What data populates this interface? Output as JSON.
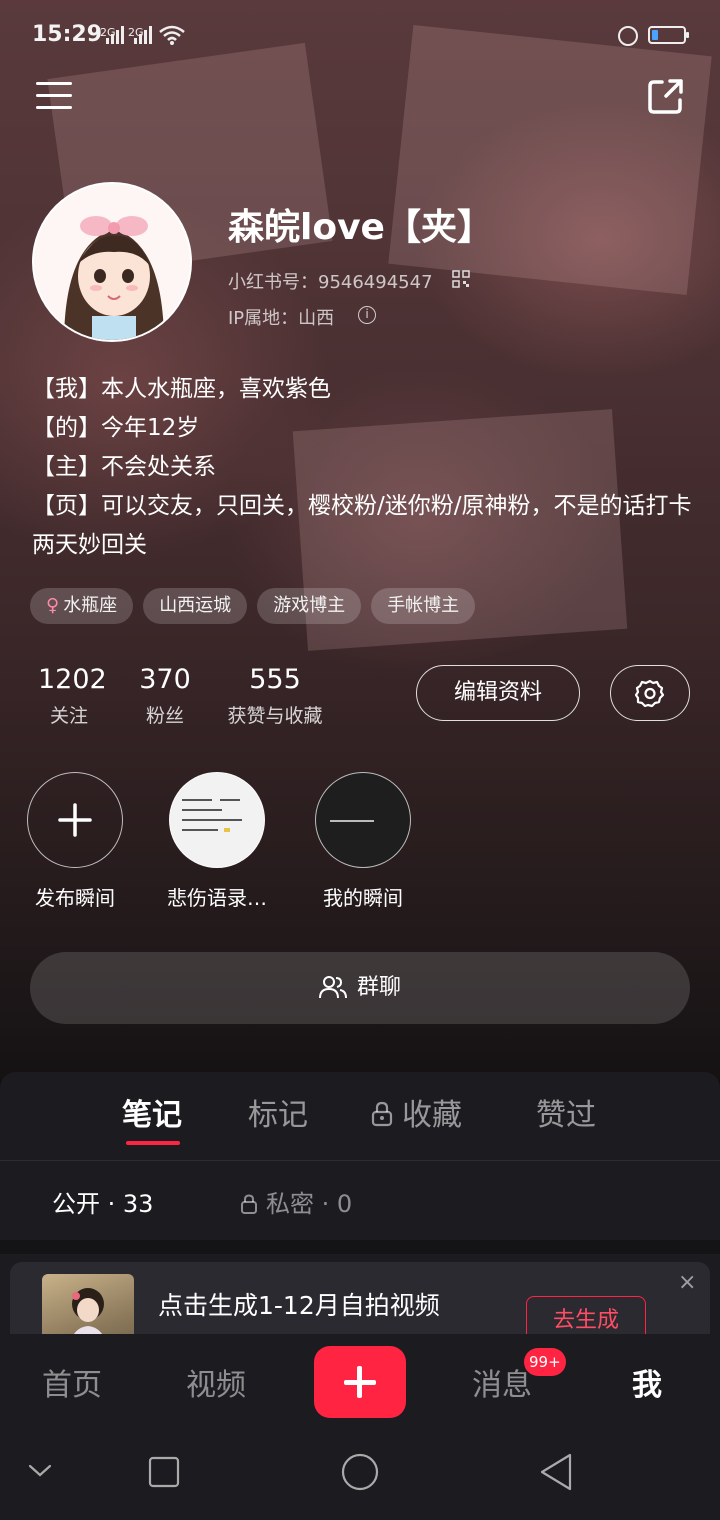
{
  "status_bar": {
    "time": "15:29",
    "signal1": "2G",
    "signal2": "2G"
  },
  "profile": {
    "nickname": "森皖love【夹】",
    "red_id": "小红书号：9546494547",
    "ip_location": "IP属地：山西",
    "bio": [
      "【我】本人水瓶座，喜欢紫色",
      "【的】今年12岁",
      "【主】不会处关系",
      "【页】可以交友，只回关，樱校粉/迷你粉/原神粉，不是的话打卡两天妙回关"
    ],
    "gender_symbol": "♀",
    "tags": [
      "水瓶座",
      "山西运城",
      "游戏博主",
      "手帐博主"
    ]
  },
  "stats": [
    {
      "value": "1202",
      "label": "关注"
    },
    {
      "value": "370",
      "label": "粉丝"
    },
    {
      "value": "555",
      "label": "获赞与收藏"
    }
  ],
  "buttons": {
    "edit_profile": "编辑资料",
    "group_chat": "群聊"
  },
  "moments": [
    {
      "label": "发布瞬间"
    },
    {
      "label": "悲伤语录…"
    },
    {
      "label": "我的瞬间"
    }
  ],
  "content_tabs": [
    {
      "label": "笔记",
      "active": true
    },
    {
      "label": "标记",
      "active": false
    },
    {
      "label": "收藏",
      "active": false,
      "locked": true
    },
    {
      "label": "赞过",
      "active": false
    }
  ],
  "sub_tabs": {
    "public": "公开 · 33",
    "private": "私密 · 0"
  },
  "promo": {
    "title": "点击生成1-12月自拍视频",
    "button": "去生成",
    "close": "×"
  },
  "bottom_nav": [
    {
      "label": "首页",
      "active": false
    },
    {
      "label": "视频",
      "active": false
    },
    {
      "label": "消息",
      "active": false,
      "badge": "99+"
    },
    {
      "label": "我",
      "active": true
    }
  ],
  "colors": {
    "accent": "#ff2442",
    "panel": "#1c1c20"
  }
}
